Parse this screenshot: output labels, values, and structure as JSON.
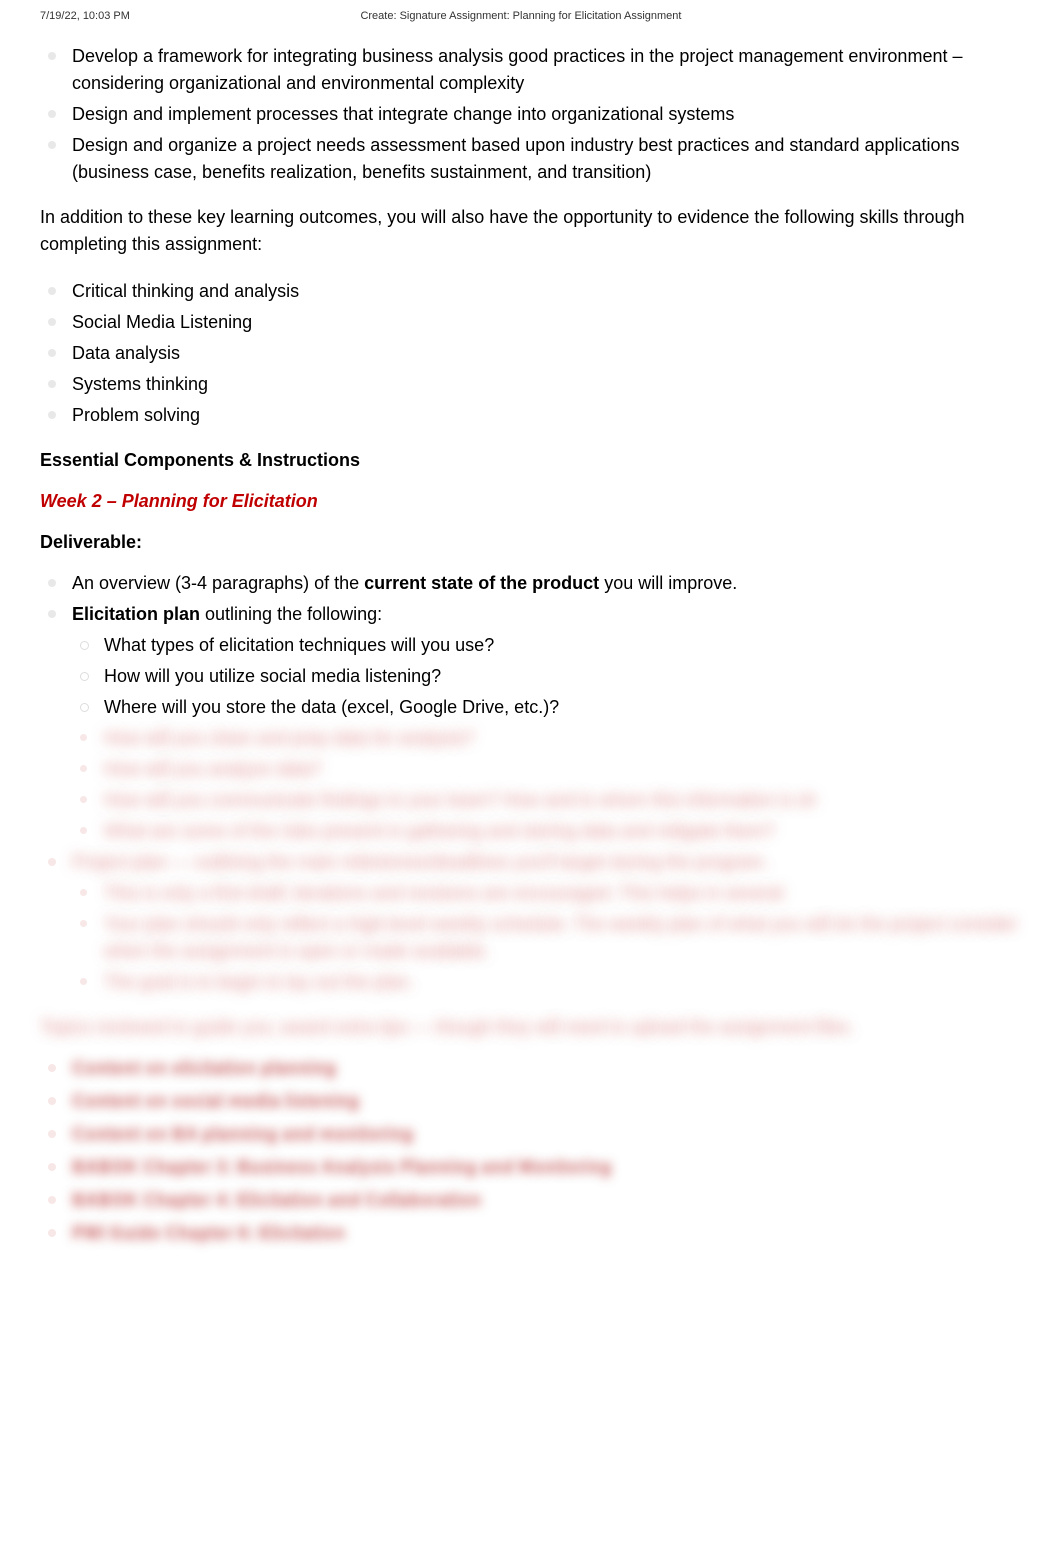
{
  "header": {
    "datetime": "7/19/22, 10:03 PM",
    "title": "Create: Signature Assignment: Planning for Elicitation Assignment"
  },
  "outcomes": [
    "Develop a framework for integrating business analysis good practices in the project management environment – considering organizational and environmental complexity",
    "Design and implement processes that integrate change into organizational systems",
    "Design and organize a project needs assessment based upon industry best practices and standard applications (business case, benefits realization, benefits sustainment, and transition)"
  ],
  "para1": "In addition to these key learning outcomes, you will also have the opportunity to evidence the following skills through completing this assignment:",
  "skills": [
    "Critical thinking and analysis",
    "Social Media Listening",
    "Data analysis",
    "Systems thinking",
    "Problem solving"
  ],
  "essential_heading": "Essential Components & Instructions",
  "week_heading": "Week 2 – Planning for Elicitation",
  "deliverable_heading": "Deliverable:",
  "deliverables": {
    "item1_pre": "An overview (3-4 paragraphs) of the ",
    "item1_bold": "current state of the product",
    "item1_post": " you will improve.",
    "item2_bold": "Elicitation plan",
    "item2_post": " outlining the following:",
    "sub": [
      "What types of elicitation techniques will you use?",
      "How will you utilize social media listening?",
      "Where will you store the data (excel, Google Drive, etc.)?"
    ]
  },
  "blurred_sub": [
    "How will you clean and prep data for analysis?",
    "How will you analyze data?",
    "How will you communicate findings to your team? How and to whom this information is sh",
    "What are some of the risks present in gathering and storing data and mitigate them?"
  ],
  "blurred_item3": "Project plan — outlining the main milestones/deadlines you'll target during the program.",
  "blurred_item3_sub": [
    "This is only a first draft; iterations and revisions are encouraged.                                  This helps in several",
    "Your plan should only reflect a high-level weekly schedule. The weekly plan of what you will do        the project                                consider when the assignment is open or made available.",
    "The goal is to begin to lay out the plan."
  ],
  "blurred_para": "Topics reviewed to guide you; award extra tips — though they will need to upload the assignment files.",
  "refs": [
    "Content on elicitation planning",
    "Content on social media listening",
    "Content on BA planning and monitoring",
    "BABOK Chapter 3: Business Analysis Planning and Monitoring",
    "BABOK Chapter 4: Elicitation and Collaboration",
    "PMI Guide Chapter 6: Elicitation"
  ]
}
